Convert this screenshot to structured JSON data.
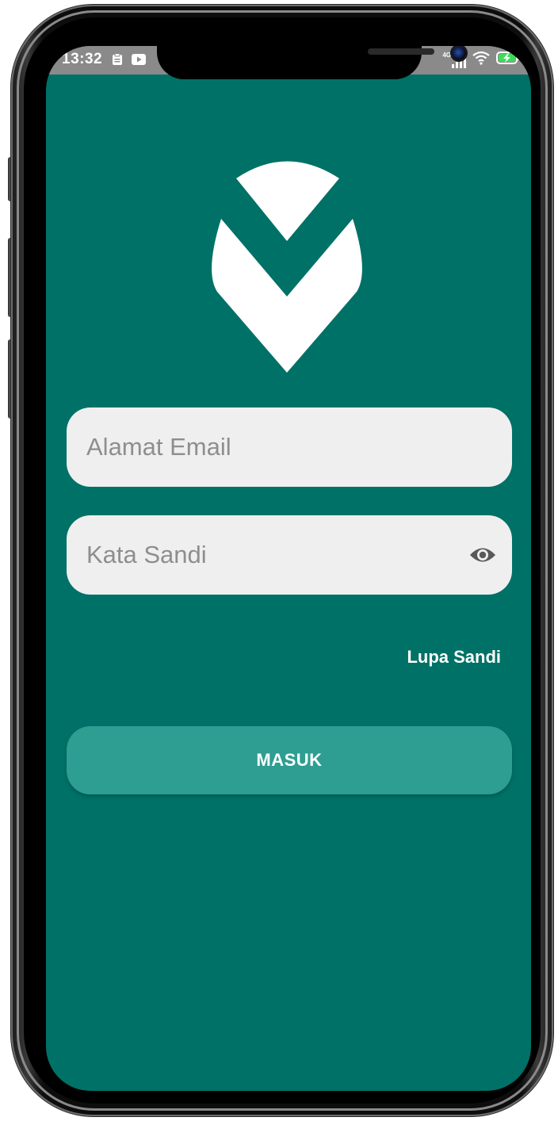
{
  "status_bar": {
    "time": "13:32",
    "left_icons": [
      "clipboard-icon",
      "youtube-icon"
    ],
    "right_icons": [
      "4g-signal-icon",
      "wifi-icon",
      "battery-charging-icon"
    ],
    "network_label": "4G"
  },
  "app": {
    "logo_icon": "v-checkmark-logo",
    "email": {
      "placeholder": "Alamat Email",
      "value": ""
    },
    "password": {
      "placeholder": "Kata Sandi",
      "value": "",
      "toggle_icon": "eye-icon"
    },
    "forgot_password_label": "Lupa Sandi",
    "login_button_label": "MASUK"
  },
  "colors": {
    "background": "#007166",
    "field_background": "#efefef",
    "button": "#2d9e91",
    "status_bar": "#8a8a8a"
  }
}
